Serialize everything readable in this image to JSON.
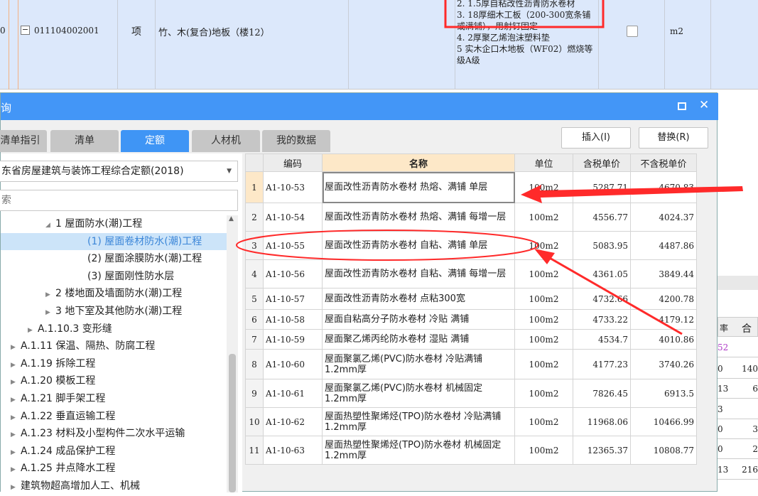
{
  "background_row": {
    "row_num": "0",
    "code": "011104002001",
    "type": "项",
    "name": "竹、木(复合)地板（楼12）",
    "description": [
      "2.  1.5厚自粘改性沥青防水卷材",
      "3.  18厚细木工板（200-300宽条铺或满铺），用射钉固定",
      "4.  2厚聚乙烯泡沫塑料垫",
      "5  实木企口木地板（WF02）燃烧等级A级"
    ],
    "unit": "m2"
  },
  "right_fragment": {
    "header": [
      "率",
      "合"
    ],
    "cells": [
      [
        "52",
        ""
      ],
      [
        "0",
        "140"
      ],
      [
        "13",
        "6"
      ],
      [
        "3",
        ""
      ],
      [
        "0",
        "3"
      ],
      [
        "0",
        "2"
      ],
      [
        "13",
        "216"
      ]
    ]
  },
  "dialog": {
    "title": "询",
    "tabs": [
      {
        "label": "清单指引"
      },
      {
        "label": "清单"
      },
      {
        "label": "定额",
        "active": true
      },
      {
        "label": "人材机"
      },
      {
        "label": "我的数据"
      }
    ],
    "insert_button": "插入(I)",
    "replace_button": "替换(R)",
    "library_select": "东省房屋建筑与装饰工程综合定额(2018)",
    "search_placeholder": "索",
    "tree": [
      {
        "label": "1 屋面防水(潮)工程",
        "level": 3,
        "state": "expanded"
      },
      {
        "label": "(1) 屋面卷材防水(潮)工程",
        "level": 4,
        "selected": true
      },
      {
        "label": "(2) 屋面涂膜防水(潮)工程",
        "level": 4
      },
      {
        "label": "(3) 屋面刚性防水层",
        "level": 4
      },
      {
        "label": "2 楼地面及墙面防水(潮)工程",
        "level": 3,
        "state": "collapsed"
      },
      {
        "label": "3 地下室及其他防水(潮)工程",
        "level": 3,
        "state": "collapsed"
      },
      {
        "label": "A.1.10.3 变形缝",
        "level": 2,
        "state": "collapsed"
      },
      {
        "label": "A.1.11 保温、隔热、防腐工程",
        "level": 1,
        "state": "collapsed"
      },
      {
        "label": "A.1.19 拆除工程",
        "level": 1,
        "state": "collapsed"
      },
      {
        "label": "A.1.20 模板工程",
        "level": 1,
        "state": "collapsed"
      },
      {
        "label": "A.1.21 脚手架工程",
        "level": 1,
        "state": "collapsed"
      },
      {
        "label": "A.1.22 垂直运输工程",
        "level": 1,
        "state": "collapsed"
      },
      {
        "label": "A.1.23 材料及小型构件二次水平运输",
        "level": 1,
        "state": "collapsed"
      },
      {
        "label": "A.1.24 成品保护工程",
        "level": 1,
        "state": "collapsed"
      },
      {
        "label": "A.1.25 井点降水工程",
        "level": 1,
        "state": "collapsed"
      },
      {
        "label": "建筑物超高增加人工、机械",
        "level": 1,
        "state": "collapsed"
      }
    ],
    "table": {
      "columns": [
        "",
        "编码",
        "名称",
        "单位",
        "含税单价",
        "不含税单价"
      ],
      "rows": [
        [
          "1",
          "A1-10-53",
          "屋面改性沥青防水卷材 热熔、满铺 单层",
          "100m2",
          "5287.71",
          "4670.83"
        ],
        [
          "2",
          "A1-10-54",
          "屋面改性沥青防水卷材 热熔、满铺 每增一层",
          "100m2",
          "4556.77",
          "4024.37"
        ],
        [
          "3",
          "A1-10-55",
          "屋面改性沥青防水卷材 自粘、满铺 单层",
          "100m2",
          "5083.95",
          "4487.86"
        ],
        [
          "4",
          "A1-10-56",
          "屋面改性沥青防水卷材 自粘、满铺 每增一层",
          "100m2",
          "4361.05",
          "3849.44"
        ],
        [
          "5",
          "A1-10-57",
          "屋面改性沥青防水卷材 点粘300宽",
          "100m2",
          "4732.66",
          "4200.78"
        ],
        [
          "6",
          "A1-10-58",
          "屋面自粘高分子防水卷材 冷贴 满铺",
          "100m2",
          "4733.22",
          "4179.12"
        ],
        [
          "7",
          "A1-10-59",
          "屋面聚乙烯丙纶防水卷材 湿贴 满铺",
          "100m2",
          "4534.7",
          "4010.86"
        ],
        [
          "8",
          "A1-10-60",
          "屋面聚氯乙烯(PVC)防水卷材 冷贴满铺 1.2mm厚",
          "100m2",
          "4177.23",
          "3740.26"
        ],
        [
          "9",
          "A1-10-61",
          "屋面聚氯乙烯(PVC)防水卷材 机械固定 1.2mm厚",
          "100m2",
          "7826.45",
          "6913.5"
        ],
        [
          "10",
          "A1-10-62",
          "屋面热塑性聚烯烃(TPO)防水卷材 冷贴满铺 1.2mm厚",
          "100m2",
          "11968.06",
          "10466.99"
        ],
        [
          "11",
          "A1-10-63",
          "屋面热塑性聚烯烃(TPO)防水卷材 机械固定 1.2mm厚",
          "100m2",
          "12365.37",
          "10808.77"
        ]
      ],
      "selected_row": 1
    }
  },
  "colors": {
    "titlebar": "#4396f7",
    "annotation": "#ff2a2a",
    "selection": "#cce4f9"
  }
}
